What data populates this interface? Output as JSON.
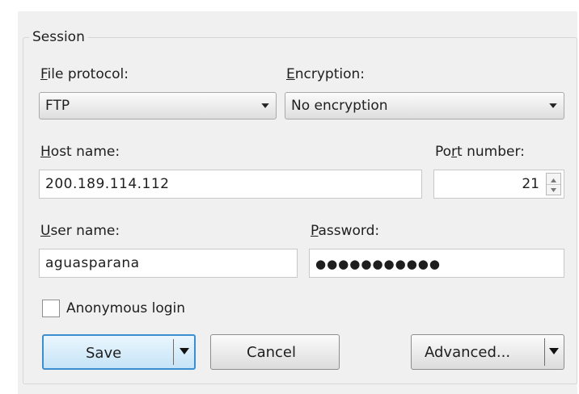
{
  "session": {
    "group_title": "Session",
    "file_protocol": {
      "label_prefix": "",
      "label_mnemonic": "F",
      "label_rest": "ile protocol:",
      "value": "FTP"
    },
    "encryption": {
      "label_prefix": "",
      "label_mnemonic": "E",
      "label_rest": "ncryption:",
      "value": "No encryption"
    },
    "host": {
      "label_prefix": "",
      "label_mnemonic": "H",
      "label_rest": "ost name:",
      "value": "200.189.114.112"
    },
    "port": {
      "label_prefix": "Po",
      "label_mnemonic": "r",
      "label_rest": "t number:",
      "value": "21"
    },
    "user": {
      "label_prefix": "",
      "label_mnemonic": "U",
      "label_rest": "ser name:",
      "value": "aguasparana"
    },
    "password": {
      "label_prefix": "",
      "label_mnemonic": "P",
      "label_rest": "assword:",
      "value": "●●●●●●●●●●●"
    },
    "anonymous": {
      "label": "Anonymous login",
      "checked": false
    }
  },
  "buttons": {
    "save": "Save",
    "cancel": "Cancel",
    "advanced": "Advanced..."
  },
  "colors": {
    "dialog_bg": "#f0f0f0",
    "focus_border": "#3c8fcf"
  }
}
